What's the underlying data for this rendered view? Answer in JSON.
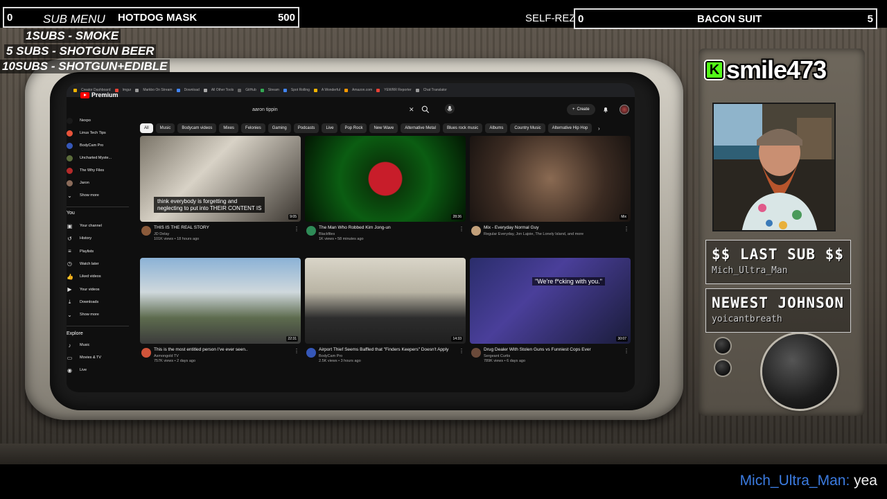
{
  "overlay": {
    "left_bar": {
      "count": "0",
      "label": "HOTDOG MASK",
      "value": "500"
    },
    "sub_menu": {
      "title": "SUB MENU",
      "lines": [
        "1SUBS   - SMOKE",
        "5 SUBS  - SHOTGUN BEER",
        "10SUBS - SHOTGUN+EDIBLE"
      ]
    },
    "self_rez": "SELF-REZ",
    "right_bar": {
      "count": "0",
      "label": "BACON SUIT",
      "value": "5"
    },
    "brand": {
      "logo_letter": "K",
      "name": "smile473"
    },
    "last_sub": {
      "title": "$$ LAST SUB $$",
      "name": "Mich_Ultra_Man"
    },
    "newest_johnson": {
      "title": "NEWEST JOHNSON",
      "name": "yoicantbreath"
    },
    "chat": {
      "user": "Mich_Ultra_Man:",
      "message": " yea"
    }
  },
  "youtube": {
    "logo": "Premium",
    "search_query": "aaron tippin",
    "create_label": "Create",
    "chips": [
      "All",
      "Music",
      "Bodycam videos",
      "Mixes",
      "Felonies",
      "Gaming",
      "Podcasts",
      "Live",
      "Pop Rock",
      "New Wave",
      "Alternative Metal",
      "Blues rock music",
      "Albums",
      "Country Music",
      "Alternative Hip Hop"
    ],
    "subscriptions": [
      {
        "name": "Nexpo",
        "color": "#1a1a1a"
      },
      {
        "name": "Linus Tech Tips",
        "color": "#e8533a"
      },
      {
        "name": "BodyCam Pro",
        "color": "#3557b8"
      },
      {
        "name": "Uncharted Myste...",
        "color": "#5a6b3a"
      },
      {
        "name": "The Why Files",
        "color": "#b52a2a"
      },
      {
        "name": "Jaron",
        "color": "#8a6b5a"
      },
      {
        "name": "Show more",
        "color": ""
      }
    ],
    "you_heading": "You",
    "you_items": [
      "Your channel",
      "History",
      "Playlists",
      "Watch later",
      "Liked videos",
      "Your videos",
      "Downloads",
      "Show more"
    ],
    "explore_heading": "Explore",
    "explore_items": [
      "Music",
      "Movies & TV",
      "Live"
    ],
    "videos": [
      {
        "title": "THIS IS THE REAL STORY",
        "channel": "JD Delay",
        "stats": "101K views • 18 hours ago",
        "duration": "9:05",
        "caption": "think everybody is forgetting and\nneglecting to put into THEIR CONTENT IS"
      },
      {
        "title": "The Man Who Robbed Kim Jong-un",
        "channel": "Blackfiles",
        "stats": "1K views • 58 minutes ago",
        "duration": "28:36"
      },
      {
        "title": "Mix - Everyday Normal Guy",
        "channel": "Regular Everyday, Jon Lajoie, The Lonely Island, and more",
        "stats": "",
        "duration": "Mix"
      },
      {
        "title": "This is the most entitled person I've ever seen..",
        "channel": "Asmongold TV",
        "stats": "757K views • 2 days ago",
        "duration": "22:31"
      },
      {
        "title": "Airport Thief Seems Baffled that \"Finders Keepers\" Doesn't Apply",
        "channel": "BodyCam Pro",
        "stats": "2.5K views • 3 hours ago",
        "duration": "14:33"
      },
      {
        "title": "Drug Dealer With Stolen Guns vs Funniest Cops Ever",
        "channel": "Sergeant Curtis",
        "stats": "789K views • 6 days ago",
        "duration": "30:07",
        "quote": "\"We're f*cking with you.\""
      }
    ]
  },
  "colors": {
    "kick_green": "#53fc18",
    "yt_red": "#ff0000",
    "chat_user": "#3b7be0"
  }
}
